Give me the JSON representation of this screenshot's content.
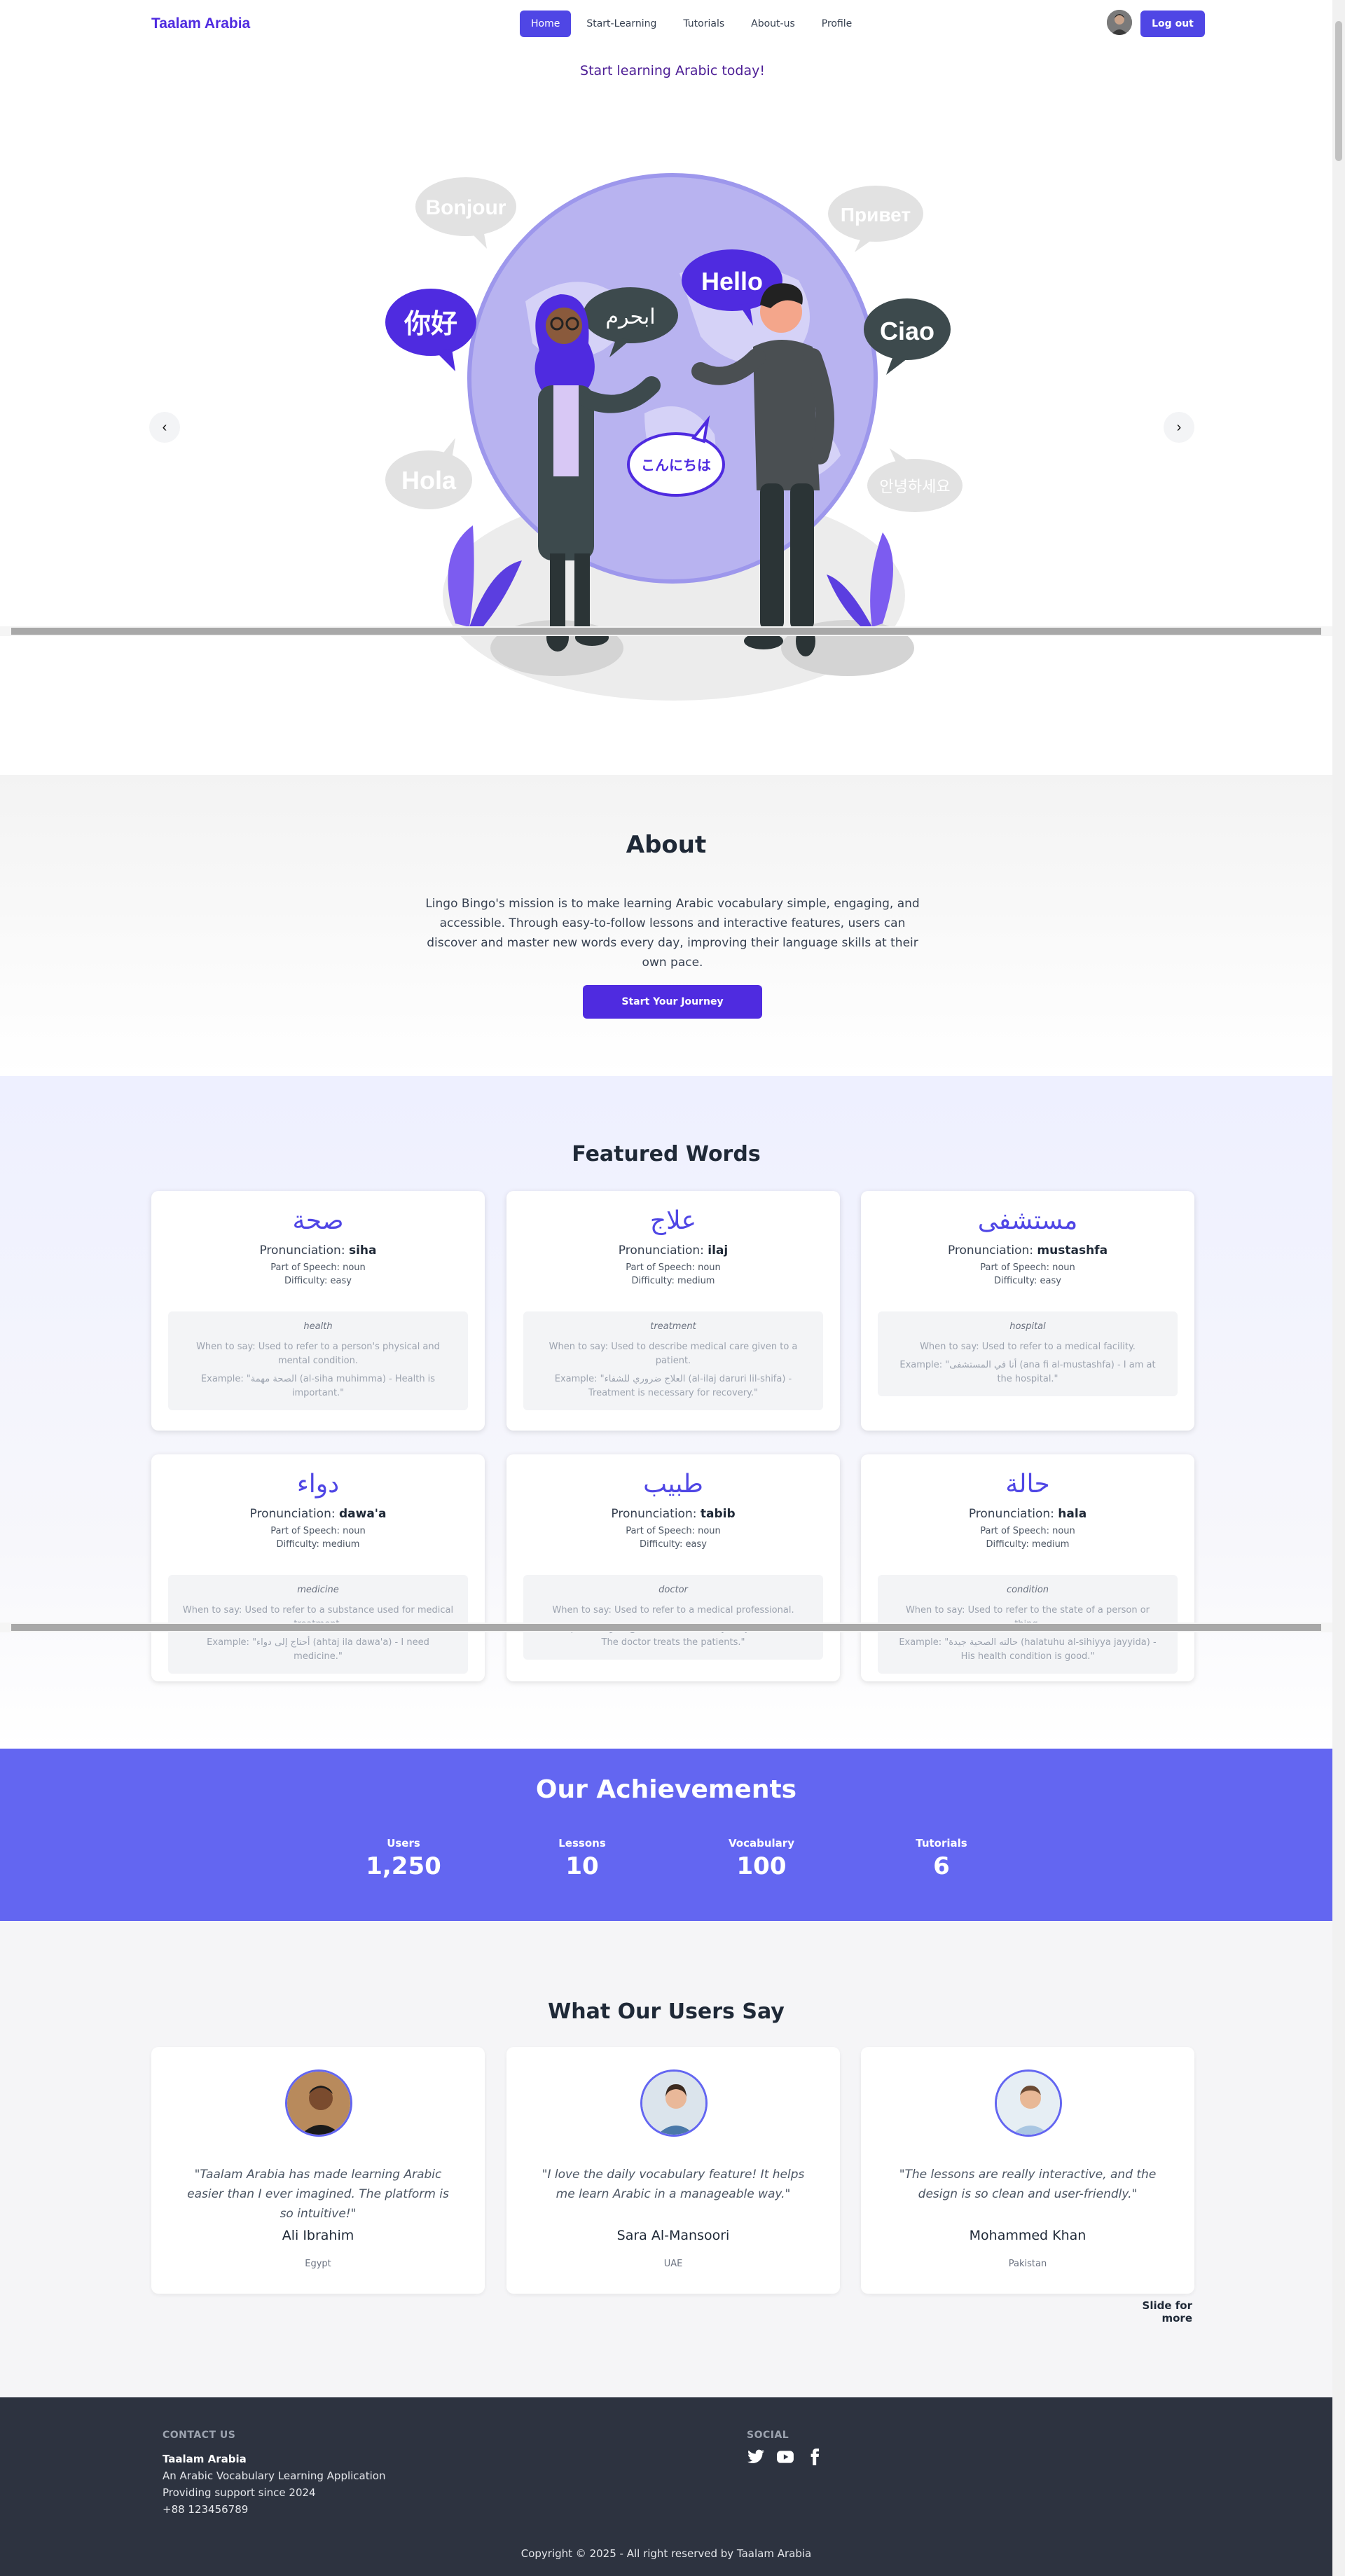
{
  "nav": {
    "brand": "Taalam Arabia",
    "items": [
      "Home",
      "Start-Learning",
      "Tutorials",
      "About-us",
      "Profile"
    ],
    "active": "Home",
    "logout": "Log out"
  },
  "hero": {
    "tagline": "Start learning Arabic today!",
    "bubbles": [
      "Bonjour",
      "Привет",
      "你好",
      "ابحرم",
      "Hello",
      "Ciao",
      "Hola",
      "こんにちは",
      "안녕하세요"
    ],
    "prev_icon": "‹",
    "next_icon": "›"
  },
  "about": {
    "title": "About",
    "text": "Lingo Bingo's mission is to make learning Arabic vocabulary simple, engaging, and accessible. Through easy-to-follow lessons and interactive features, users can discover and master new words every day, improving their language skills at their own pace.",
    "cta": "Start Your Journey"
  },
  "featured": {
    "title": "Featured Words",
    "pron_label": "Pronunciation: ",
    "pos_label": "Part of Speech: ",
    "diff_label": "Difficulty: ",
    "words": [
      {
        "arabic": "صحة",
        "pron": "siha",
        "pos": "noun",
        "difficulty": "easy",
        "meaning": "health",
        "when": "When to say: Used to refer to a person's physical and mental condition.",
        "example": "Example: \"الصحة مهمة (al-siha muhimma) - Health is important.\""
      },
      {
        "arabic": "علاج",
        "pron": "ilaj",
        "pos": "noun",
        "difficulty": "medium",
        "meaning": "treatment",
        "when": "When to say: Used to describe medical care given to a patient.",
        "example": "Example: \"العلاج ضروري للشفاء (al-ilaj daruri lil-shifa) - Treatment is necessary for recovery.\""
      },
      {
        "arabic": "مستشفى",
        "pron": "mustashfa",
        "pos": "noun",
        "difficulty": "easy",
        "meaning": "hospital",
        "when": "When to say: Used to refer to a medical facility.",
        "example": "Example: \"أنا في المستشفى (ana fi al-mustashfa) - I am at the hospital.\""
      },
      {
        "arabic": "دواء",
        "pron": "dawa'a",
        "pos": "noun",
        "difficulty": "medium",
        "meaning": "medicine",
        "when": "When to say: Used to refer to a substance used for medical treatment.",
        "example": "Example: \"أحتاج إلى دواء (ahtaj ila dawa'a) - I need medicine.\""
      },
      {
        "arabic": "طبيب",
        "pron": "tabib",
        "pos": "noun",
        "difficulty": "easy",
        "meaning": "doctor",
        "when": "When to say: Used to refer to a medical professional.",
        "example": "Example: \"الطبيب يعالج المرضى (al-tabib yu'alij al-marda) - The doctor treats the patients.\""
      },
      {
        "arabic": "حالة",
        "pron": "hala",
        "pos": "noun",
        "difficulty": "medium",
        "meaning": "condition",
        "when": "When to say: Used to refer to the state of a person or thing.",
        "example": "Example: \"حالته الصحية جيدة (halatuhu al-sihiyya jayyida) - His health condition is good.\""
      }
    ]
  },
  "achievements": {
    "title": "Our Achievements",
    "stats": [
      {
        "label": "Users",
        "value": "1,250"
      },
      {
        "label": "Lessons",
        "value": "10"
      },
      {
        "label": "Vocabulary",
        "value": "100"
      },
      {
        "label": "Tutorials",
        "value": "6"
      }
    ]
  },
  "testimonials": {
    "title": "What Our Users Say",
    "items": [
      {
        "quote": "\"Taalam Arabia has made learning Arabic easier than I ever imagined. The platform is so intuitive!\"",
        "name": "Ali Ibrahim",
        "country": "Egypt"
      },
      {
        "quote": "\"I love the daily vocabulary feature! It helps me learn Arabic in a manageable way.\"",
        "name": "Sara Al-Mansoori",
        "country": "UAE"
      },
      {
        "quote": "\"The lessons are really interactive, and the design is so clean and user-friendly.\"",
        "name": "Mohammed Khan",
        "country": "Pakistan"
      }
    ],
    "more": "Slide for more"
  },
  "footer": {
    "contact_head": "CONTACT US",
    "company": "Taalam Arabia",
    "line1": "An Arabic Vocabulary Learning Application",
    "line2": "Providing support since 2024",
    "phone": "+88 123456789",
    "social_head": "SOCIAL",
    "socials": [
      "twitter-icon",
      "youtube-icon",
      "facebook-icon"
    ],
    "copyright": "Copyright © 2025 - All right reserved by Taalam Arabia"
  },
  "colors": {
    "primary": "#4f46e5",
    "brand": "#4f2be0",
    "achievement_bg": "#6366f1",
    "footer_bg": "#2d3340"
  }
}
